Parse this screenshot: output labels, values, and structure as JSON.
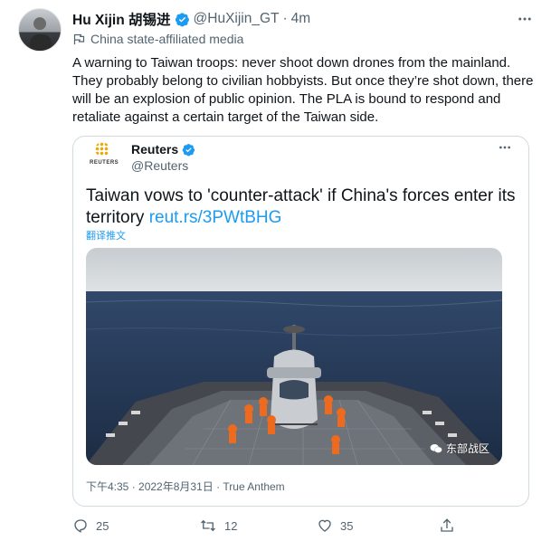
{
  "tweet": {
    "author_name": "Hu Xijin 胡锡进",
    "handle": "@HuXijin_GT",
    "separator": "·",
    "time": "4m",
    "label": "China state-affiliated media",
    "text": "A warning to Taiwan troops: never shoot down drones from the mainland. They probably belong to civilian hobbyists. But once they’re shot down, there will be an explosion of public opinion. The PLA is bound to respond and retaliate against a certain target of the Taiwan side."
  },
  "quote": {
    "logo_word": "REUTERS",
    "author_name": "Reuters",
    "handle": "@Reuters",
    "headline": "Taiwan vows to 'counter-attack' if China's forces enter its territory ",
    "link": "reut.rs/3PWtBHG",
    "translate": "翻译推文",
    "watermark": "东部战区",
    "timestamp": "下午4:35 · 2022年8月31日 · True Anthem"
  },
  "actions": {
    "replies": "25",
    "retweets": "12",
    "likes": "35"
  },
  "colors": {
    "verified": "#1d9bf0",
    "link": "#1d9bf0",
    "muted": "#536471",
    "border": "#cfd9de"
  },
  "icons": [
    "verified-badge-icon",
    "flag-icon",
    "more-icon",
    "reply-icon",
    "retweet-icon",
    "like-icon",
    "share-icon"
  ]
}
